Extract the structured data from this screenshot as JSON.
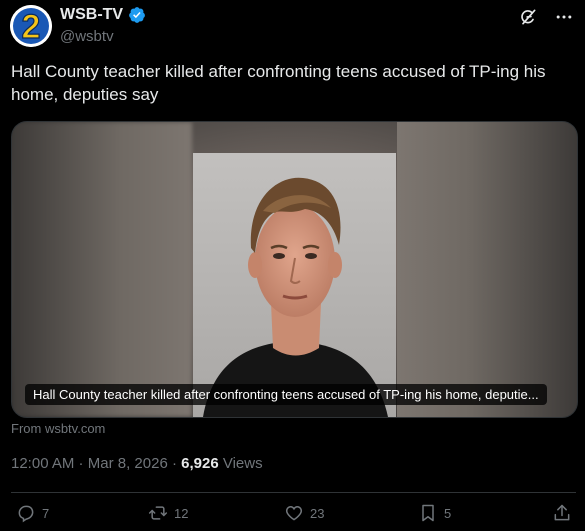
{
  "account": {
    "display_name": "WSB-TV",
    "handle": "@wsbtv",
    "logo_text": "2"
  },
  "tweet": {
    "text": "Hall County teacher killed after confronting teens accused of TP-ing his home, deputies say"
  },
  "card": {
    "caption": "Hall County teacher killed after confronting teens accused of TP-ing his home, deputie...",
    "source": "From wsbtv.com"
  },
  "meta": {
    "time": "12:00 AM",
    "separator": " · ",
    "date": "Mar 8, 2026",
    "views_count": "6,926",
    "views_label": " Views"
  },
  "actions": {
    "replies": "7",
    "reposts": "12",
    "likes": "23",
    "bookmarks": "5"
  },
  "icons": {
    "top": [
      "grok-icon",
      "more-icon"
    ],
    "actions": [
      "reply-icon",
      "repost-icon",
      "like-icon",
      "bookmark-icon",
      "share-icon"
    ]
  },
  "colors": {
    "background": "#000000",
    "text": "#e7e9ea",
    "muted": "#71767b",
    "verified": "#1d9bf0",
    "logo_blue": "#1a58b5",
    "logo_yellow": "#f5c518"
  }
}
